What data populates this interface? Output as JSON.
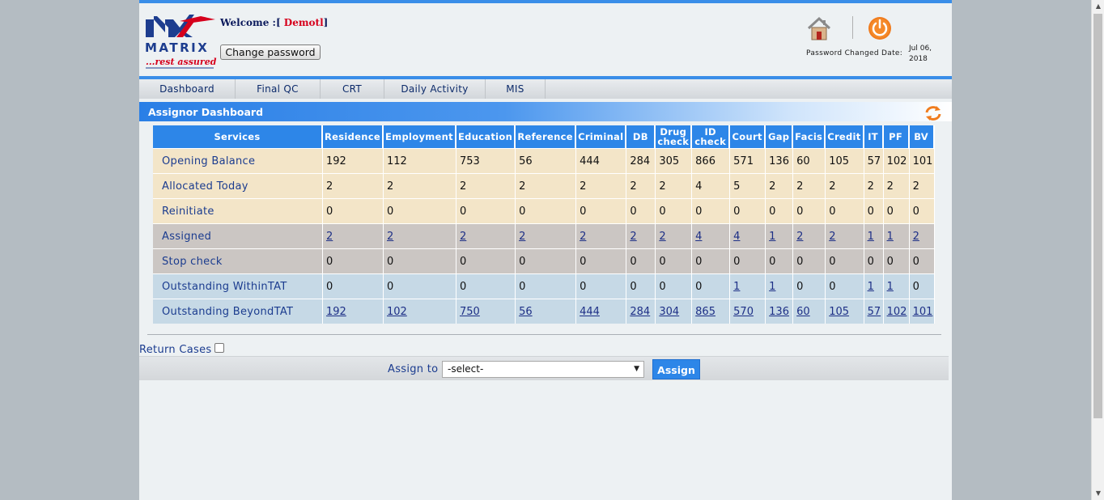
{
  "header": {
    "welcome_prefix": "Welcome :[",
    "user": " Demotl",
    "welcome_suffix": "]",
    "change_password": "Change password",
    "pw_changed_label": "Password Changed Date:",
    "pw_changed_date": "Jul 06, 2018",
    "logo_text": "MATRIX",
    "logo_tagline": "...rest assured",
    "home_icon": "home-icon",
    "power_icon": "power-icon"
  },
  "nav": {
    "items": [
      {
        "label": "Dashboard"
      },
      {
        "label": "Final QC"
      },
      {
        "label": "CRT"
      },
      {
        "label": "Daily Activity"
      },
      {
        "label": "MIS"
      }
    ]
  },
  "panel": {
    "title": "Assignor Dashboard",
    "refresh_icon": "refresh-icon"
  },
  "table": {
    "headers": [
      "Services",
      "Residence",
      "Employment",
      "Education",
      "Reference",
      "Criminal",
      "DB",
      "Drug check",
      "ID check",
      "Court",
      "Gap",
      "Facis",
      "Credit",
      "IT",
      "PF",
      "BV"
    ],
    "rows": [
      {
        "label": "Opening Balance",
        "style": "tan",
        "link": false,
        "values": [
          "192",
          "112",
          "753",
          "56",
          "444",
          "284",
          "305",
          "866",
          "571",
          "136",
          "60",
          "105",
          "57",
          "102",
          "101"
        ]
      },
      {
        "label": "Allocated Today",
        "style": "tan",
        "link": false,
        "values": [
          "2",
          "2",
          "2",
          "2",
          "2",
          "2",
          "2",
          "4",
          "5",
          "2",
          "2",
          "2",
          "2",
          "2",
          "2"
        ]
      },
      {
        "label": "Reinitiate",
        "style": "tan",
        "link": false,
        "values": [
          "0",
          "0",
          "0",
          "0",
          "0",
          "0",
          "0",
          "0",
          "0",
          "0",
          "0",
          "0",
          "0",
          "0",
          "0"
        ]
      },
      {
        "label": "Assigned",
        "style": "gray",
        "link": true,
        "values": [
          "2",
          "2",
          "2",
          "2",
          "2",
          "2",
          "2",
          "4",
          "4",
          "1",
          "2",
          "2",
          "1",
          "1",
          "2"
        ]
      },
      {
        "label": "Stop check",
        "style": "gray",
        "link": false,
        "values": [
          "0",
          "0",
          "0",
          "0",
          "0",
          "0",
          "0",
          "0",
          "0",
          "0",
          "0",
          "0",
          "0",
          "0",
          "0"
        ]
      },
      {
        "label": "Outstanding WithinTAT",
        "style": "blue",
        "link": "mixed",
        "values": [
          "0",
          "0",
          "0",
          "0",
          "0",
          "0",
          "0",
          "0",
          "1",
          "1",
          "0",
          "0",
          "1",
          "1",
          "0"
        ]
      },
      {
        "label": "Outstanding BeyondTAT",
        "style": "blue",
        "link": true,
        "values": [
          "192",
          "102",
          "750",
          "56",
          "444",
          "284",
          "304",
          "865",
          "570",
          "136",
          "60",
          "105",
          "57",
          "102",
          "101"
        ]
      }
    ]
  },
  "footer": {
    "return_cases": "Return Cases",
    "assign_to": "Assign to",
    "select_value": "-select-",
    "assign_button": "Assign"
  }
}
